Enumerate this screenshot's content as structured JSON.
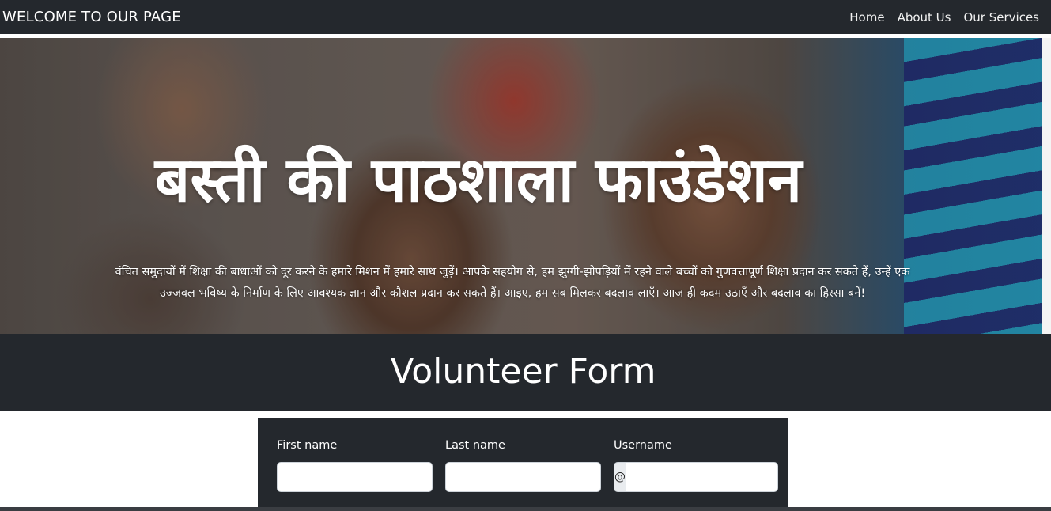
{
  "navbar": {
    "brand": "WELCOME TO OUR PAGE",
    "links": [
      "Home",
      "About Us",
      "Our Services"
    ]
  },
  "hero": {
    "title": "बस्ती की पाठशाला फाउंडेशन",
    "text": "वंचित समुदायों में शिक्षा की बाधाओं को दूर करने के हमारे मिशन में हमारे साथ जुड़ें। आपके सहयोग से, हम झुग्गी-झोपड़ियों में रहने वाले बच्चों को गुणवत्तापूर्ण शिक्षा प्रदान कर सकते हैं, उन्हें एक उज्जवल भविष्य के निर्माण के लिए आवश्यक ज्ञान और कौशल प्रदान कर सकते हैं। आइए, हम सब मिलकर बदलाव लाएँ। आज ही कदम उठाएँ और बदलाव का हिस्सा बनें!"
  },
  "form": {
    "heading": "Volunteer Form",
    "first_name_label": "First name",
    "first_name_value": "",
    "last_name_label": "Last name",
    "last_name_value": "",
    "username_label": "Username",
    "username_prefix": "@",
    "username_value": ""
  },
  "colors": {
    "navbar_bg": "#24282d",
    "accent_text": "#ffffff"
  }
}
